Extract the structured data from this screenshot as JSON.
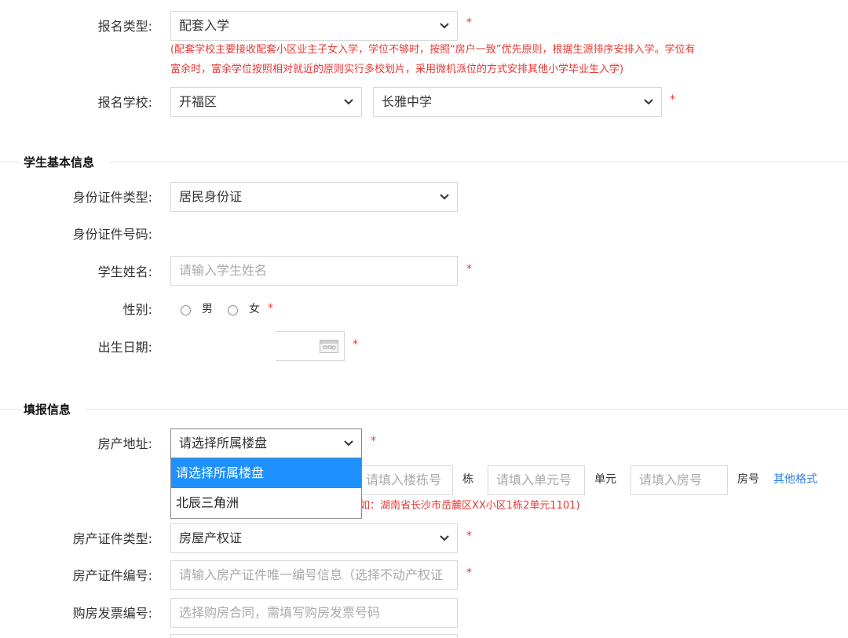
{
  "registration": {
    "type_label": "报名类型:",
    "type_value": "配套入学",
    "type_note_line1": "(配套学校主要接收配套小区业主子女入学，学位不够时，按照“房户一致”优先原则，根据生源排序安排入学。学位有",
    "type_note_line2": "富余时，富余学位按照相对就近的原则实行多校划片，采用微机派位的方式安排其他小学毕业生入学)",
    "school_label": "报名学校:",
    "district_value": "开福区",
    "school_value": "长雅中学",
    "required_mark": "*"
  },
  "student": {
    "section_title": "学生基本信息",
    "id_type_label": "身份证件类型:",
    "id_type_value": "居民身份证",
    "id_number_label": "身份证件号码:",
    "name_label": "学生姓名:",
    "name_placeholder": "请输入学生姓名",
    "gender_label": "性别:",
    "gender_male": "男",
    "gender_female": "女",
    "birthdate_label": "出生日期:"
  },
  "filing": {
    "section_title": "填报信息",
    "property_label": "房产地址:",
    "property_value": "请选择所属楼盘",
    "dropdown_options": [
      "请选择所属楼盘",
      "北辰三角洲"
    ],
    "building_placeholder": "请填入楼栋号",
    "building_unit_text": "栋",
    "unit_placeholder": "请填入单元号",
    "unit_text": "单元",
    "room_placeholder": "请填入房号",
    "room_text": "房号",
    "other_format_link": "其他格式",
    "address_example": "如：湖南省长沙市岳麓区XX小区1栋2单元1101)",
    "cert_type_label": "房产证件类型:",
    "cert_type_value": "房屋产权证",
    "cert_number_label": "房产证件编号:",
    "cert_number_placeholder": "请输入房产证件唯一编号信息（选择不动产权证",
    "invoice_label": "购房发票编号:",
    "invoice_placeholder": "选择购房合同，需填写购房发票号码"
  },
  "colors": {
    "required": "#e53935",
    "link": "#2b7de9",
    "dropdown_selected": "#1e90ff"
  }
}
